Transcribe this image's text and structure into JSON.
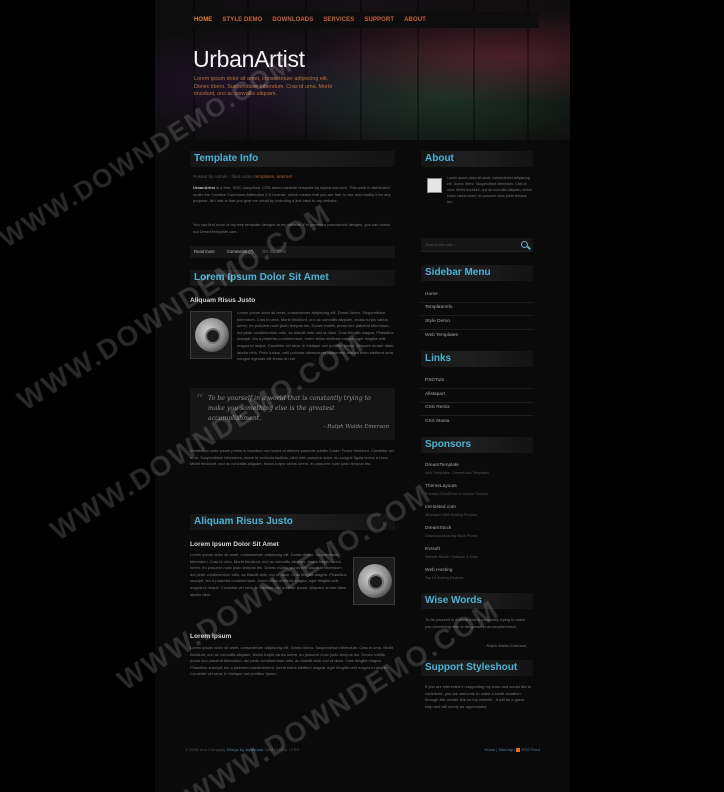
{
  "nav": [
    "HOME",
    "STYLE DEMO",
    "DOWNLOADS",
    "SERVICES",
    "SUPPORT",
    "ABOUT"
  ],
  "site": {
    "title": "UrbanArtist",
    "tagline": "Lorem ipsum dolor sit amet, consectetuer adipiscing elit. Donec libero. Suspendisse bibendum. Cras id urna. Morbi tincidunt, orci ac convallis aliquam."
  },
  "template_info": {
    "title": "Template Info",
    "meta": "Posted by Admin - filed under",
    "meta_link": "templates, internet",
    "p1_lead": "UrbanArtist",
    "p1": "is a free, W3C-compliant, CSS-based website template by styleshout.com. This work is distributed under the Creative Commons Attribution 2.5 License, which means that you are free to use and modify it for any purpose. All I ask is that you give me credit by including a link back to my website.",
    "p2": "You can find more of my free template designs at my website. For premium commercial designs, you can check out DreamTemplate.com.",
    "read_more": "Read more",
    "comments": "Comments (7)",
    "date": "Oct 01, 2006"
  },
  "post1": {
    "title": "Lorem Ipsum Dolor Sit Amet",
    "subtitle": "Aliquam Risus Justo",
    "p1": "Lorem ipsum dolor sit amet, consectetuer adipiscing elit. Donec libero. Suspendisse bibendum. Cras id urna. Morbi tincidunt, orci ac convallis aliquam, lectus turpis varius lorem, eu posuere nunc justo tempus leo. Donec mattis, purus nec placerat bibendum, dui pede condimentum odio, ac blandit ante orci ut diam. Cras fringilla magna. Phasellus suscipit, leo a pharetra condimentum, lorem tellus eleifend magna, eget fringilla velit magna id neque. Curabitur vel urna. In tristique orci porttitor ipsum. Aliquam ornare diam iaculis nibh. Proin luctus, velit pulvinar ullamcorper nonummy, mauris enim eleifend urna, congue egestas elit lectus eu est.",
    "quote": "To be yourself in a world that is constantly trying to make you something else is the greatest accomplishment.",
    "quote_author": "- Ralph Waldo Emerson",
    "p2": "Vestibulum ante ipsum primis in faucibus orci luctus et ultrices posuere cubilia Curae; Fusce tincidunt. Curabitur vel urna. Suspendisse bibendum, lorem id vehicula facilisis, nibh nibh posuere dolor, eu congue ligula lectus a nunc. Morbi tincidunt, orci ac convallis aliquam, lectus turpis varius lorem, eu posuere nunc justo tempus leo."
  },
  "post2": {
    "title": "Aliquam Risus Justo",
    "h_a": "Lorem Ipsum Dolor Sit Amet",
    "p_a": "Lorem ipsum dolor sit amet, consectetuer adipiscing elit. Donec libero. Suspendisse bibendum. Cras id urna. Morbi tincidunt, orci ac convallis aliquam, lectus turpis varius lorem, eu posuere nunc justo tempus leo. Donec mattis, purus nec placerat bibendum, dui pede condimentum odio, ac blandit ante orci ut diam. Cras fringilla magna. Phasellus suscipit, leo a pharetra condimentum, lorem tellus eleifend magna, eget fringilla velit magna id neque. Curabitur vel urna. In tristique orci porttitor ipsum. Aliquam ornare diam iaculis nibh.",
    "h_b": "Lorem Ipsum",
    "p_b": "Lorem ipsum dolor sit amet, consectetuer adipiscing elit. Donec libero. Suspendisse bibendum. Cras id urna. Morbi tincidunt, orci ac convallis aliquam, lectus turpis varius lorem, eu posuere nunc justo tempus leo. Donec mattis, purus nec placerat bibendum, dui pede condimentum odio, ac blandit ante orci ut diam. Cras fringilla magna. Phasellus suscipit, leo a pharetra condimentum, lorem tellus eleifend magna, eget fringilla velit magna id neque. Curabitur vel urna. In tristique orci porttitor ipsum."
  },
  "sidebar": {
    "about_title": "About",
    "about_text": "Lorem ipsum dolor sit amet, consectetuer adipiscing elit. Donec libero. Suspendisse bibendum. Cras id urna. Morbi tincidunt, orci ac convallis aliquam, lectus turpis varius lorem, eu posuere nunc justo tempus leo.",
    "search_placeholder": "Search this site...",
    "menu_title": "Sidebar Menu",
    "menu": [
      "Home",
      "TemplateInfo",
      "Style Demo",
      "Web Templates"
    ],
    "links_title": "Links",
    "links": [
      "PSDTuts",
      "Allstapart",
      "CSS Remix",
      "CSS Mania"
    ],
    "sponsors_title": "Sponsors",
    "sponsors": [
      {
        "name": "DreamTemplate",
        "desc": "Web Templates, Themes and Templates"
      },
      {
        "name": "ThemeLayouts",
        "desc": "Premium WordPress & Joomla Themes"
      },
      {
        "name": "ImHosted.com",
        "desc": "Affordable Web Hosting Provider"
      },
      {
        "name": "DreamStock",
        "desc": "Download Amazing Stock Photos"
      },
      {
        "name": "Evrsoft",
        "desc": "Website Builder Software & Tools"
      },
      {
        "name": "Web Hosting",
        "desc": "Top 10 Hosting Reviews"
      }
    ],
    "wise_title": "Wise Words",
    "wise_text": "To be yourself in a world that is constantly trying to make you something else is the greatest accomplishment.",
    "wise_author": "- Ralph Waldo Emerson",
    "support_title": "Support Styleshout",
    "support_text": "If you are interested in supporting my work and would like to contribute, you are welcome to make a small donation through the donate link on my website - it will be a great help and will surely be appreciated."
  },
  "footer": {
    "left": "© 2006 Your Company",
    "design": "Design by styleshout",
    "valid": "Valid XHTML | CSS",
    "right_links": "Home | Sitemap |",
    "rss": "RSS Feed"
  },
  "watermark": "WWW.DOWNDEMO.COM"
}
